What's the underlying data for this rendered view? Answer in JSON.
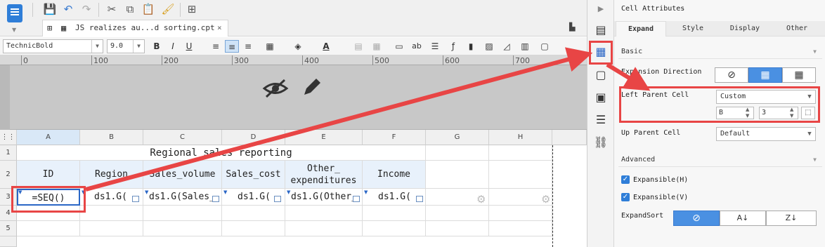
{
  "tab": {
    "title": "JS realizes au...d sorting.cpt",
    "close": "×"
  },
  "format": {
    "font": "TechnicBold",
    "size": "9.0",
    "bold": "B",
    "italic": "I",
    "underline": "U",
    "text_color": "A"
  },
  "ruler": {
    "ticks": [
      "0",
      "100",
      "200",
      "300",
      "400",
      "500",
      "600",
      "700"
    ]
  },
  "grid": {
    "columns": [
      "A",
      "B",
      "C",
      "D",
      "E",
      "F",
      "G",
      "H"
    ],
    "rows": [
      "1",
      "2",
      "3",
      "4",
      "5"
    ],
    "title": "Regional sales reporting",
    "headers": [
      "ID",
      "Region",
      "Sales_volume",
      "Sales_cost",
      "Other_\nexpenditures",
      "Income"
    ],
    "formulas": [
      "=SEQ()",
      "ds1.G(",
      "ds1.G(Sales_",
      "ds1.G(",
      "ds1.G(Other_",
      "ds1.G("
    ]
  },
  "panel": {
    "title": "Cell Attributes",
    "tabs": [
      "Expand",
      "Style",
      "Display",
      "Other"
    ],
    "basic": "Basic",
    "expansion_direction": "Expansion Direction",
    "left_parent_cell": "Left Parent Cell",
    "left_parent_value": "Custom",
    "left_col": "B",
    "left_row": "3",
    "up_parent_cell": "Up Parent Cell",
    "up_parent_value": "Default",
    "advanced": "Advanced",
    "expansible_h": "Expansible(H)",
    "expansible_v": "Expansible(V)",
    "expand_sort": "ExpandSort"
  },
  "colors": {
    "accent": "#4a90e2",
    "highlight": "#e84545"
  }
}
